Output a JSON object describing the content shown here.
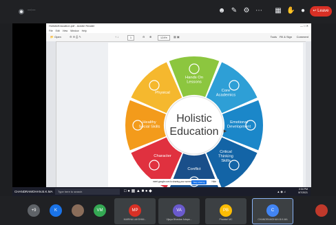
{
  "meeting": {
    "recording_label": "—:—",
    "leave_label": "Leave"
  },
  "pdf": {
    "title": "HolisticEducation.pdf - Adobe Reader",
    "menu": [
      "File",
      "Edit",
      "View",
      "Window",
      "Help"
    ],
    "open_label": "Open",
    "page_number": "1",
    "zoom": "124%",
    "tools_label": "Tools",
    "fill_sign_label": "Fill & Sign",
    "comment_label": "Comment"
  },
  "diagram": {
    "center_line1": "Holistic",
    "center_line2": "Education",
    "segments": [
      {
        "label1": "Hands On",
        "label2": "Lessons",
        "color": "#8cc63f"
      },
      {
        "label1": "Core",
        "label2": "Academics",
        "color": "#2e9fd6"
      },
      {
        "label1": "Emotional",
        "label2": "Development",
        "color": "#1b87c9"
      },
      {
        "label1": "Critical",
        "label2": "Thinking",
        "label3": "Skills",
        "color": "#1364a6"
      },
      {
        "label1": "Conflict",
        "label2": "",
        "color": "#1a4f8a"
      },
      {
        "label1": "Character",
        "label2": "",
        "color": "#e0313f"
      },
      {
        "label1": "Healthy",
        "label2": "Social Skills",
        "color": "#f39b1b"
      },
      {
        "label1": "Physical",
        "label2": "",
        "color": "#f5b82e"
      }
    ]
  },
  "taskbar": {
    "presenter": "CHANDRAMOHAN.B.K.MA",
    "search_placeholder": "Type here to search",
    "clock_time": "2:34 PM",
    "clock_date": "8/7/2021"
  },
  "sharebar": {
    "message": "meet.google.com is sharing your screen.",
    "stop_label": "Stop sharing",
    "hide_label": "Hide"
  },
  "participants": {
    "more_count": "+9",
    "people": [
      {
        "initial": "K",
        "color": "#1a73e8",
        "name": ""
      },
      {
        "initial": "VM",
        "color": "#34a853",
        "name": ""
      },
      {
        "initial": "MP",
        "color": "#d93025",
        "name": "MARINA LAKSHMI..."
      },
      {
        "initial": "VA",
        "color": "#6a5acd",
        "name": "Vijaya Bhaskar Adapa..."
      },
      {
        "initial": "PB",
        "color": "#fbbc04",
        "name": "Phanisri MC"
      },
      {
        "initial": "C",
        "color": "#4285f4",
        "name": "CHANDRAMOHAN.B.K.MA"
      }
    ]
  }
}
